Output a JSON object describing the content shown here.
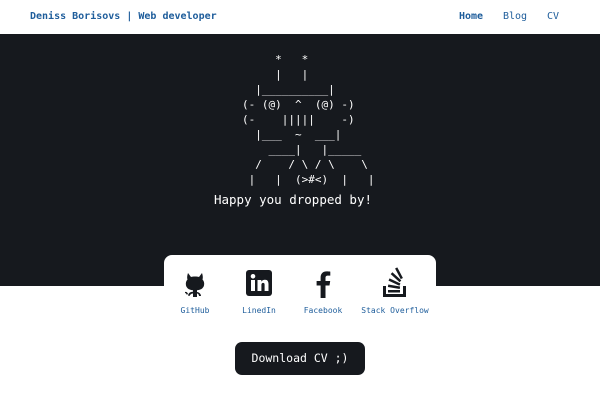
{
  "navbar": {
    "brand": "Deniss Borisovs | Web developer",
    "links": [
      {
        "label": "Home",
        "active": true
      },
      {
        "label": "Blog",
        "active": false
      },
      {
        "label": "CV",
        "active": false
      }
    ]
  },
  "hero": {
    "ascii_art": "     *   *\n     |   |\n  |__________|\n(- (@)  ^  (@) -)\n(-    |||||    -)\n  |___  ~  ___|\n    ____|   |_____\n  /    / \\ / \\    \\\n |   |  (>#<)  |   |",
    "tagline": "Happy you dropped by!"
  },
  "social": {
    "items": [
      {
        "label": "GitHub",
        "icon": "github-icon"
      },
      {
        "label": "LinedIn",
        "icon": "linkedin-icon"
      },
      {
        "label": "Facebook",
        "icon": "facebook-icon"
      },
      {
        "label": "Stack Overflow",
        "icon": "stackoverflow-icon"
      }
    ]
  },
  "download": {
    "label": "Download CV ;)"
  },
  "colors": {
    "accent": "#1e5d9b",
    "dark": "#16191e",
    "background": "#ffffff"
  }
}
